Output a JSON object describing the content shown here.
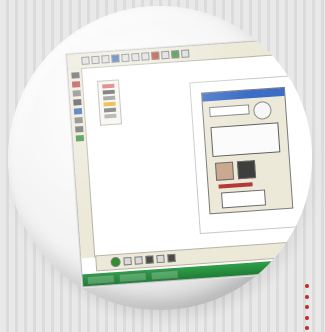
{
  "colors": {
    "dialog_title": "#3b6dc7",
    "taskbar_green": "#2f9f49",
    "accent_red": "#c72e2e",
    "toolbar_bg": "#ece9d8"
  },
  "icons": {
    "toolbar": [
      "file-icon",
      "open-icon",
      "save-icon",
      "print-icon",
      "cut-icon",
      "copy-icon",
      "paste-icon",
      "undo-icon",
      "redo-icon",
      "zoom-icon",
      "help-icon"
    ],
    "side_tools": [
      "select-icon",
      "pencil-icon",
      "shape-icon",
      "text-icon",
      "fill-icon",
      "erase-icon",
      "zoom-icon",
      "color-icon"
    ],
    "palette": [
      "brush-icon",
      "pen-icon",
      "line-icon",
      "curve-icon",
      "rect-icon",
      "circle-icon"
    ],
    "bottom_toolbar": [
      "green-circle-icon",
      "arrow-left-icon",
      "arrow-right-icon",
      "layer-icon",
      "properties-icon",
      "grid-icon"
    ]
  }
}
